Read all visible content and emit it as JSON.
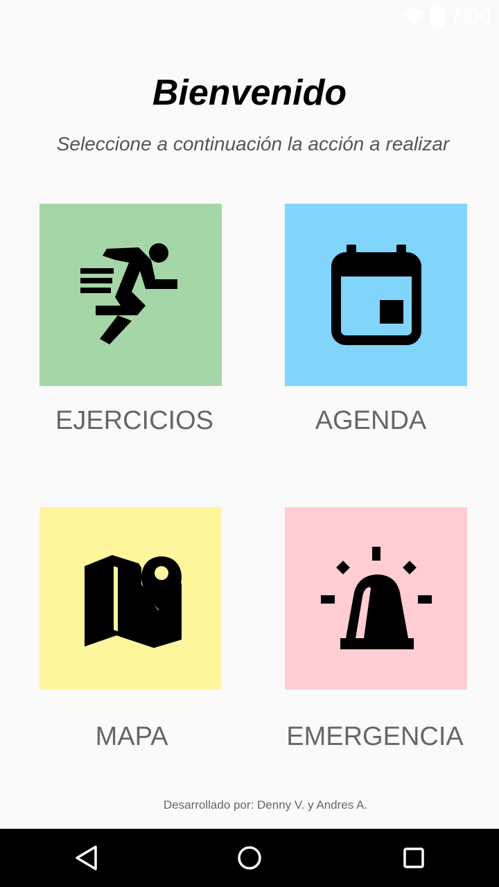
{
  "status_bar": {
    "time": "7:00",
    "icons": [
      "wifi-icon",
      "battery-icon"
    ]
  },
  "header": {
    "title": "Bienvenido",
    "subtitle": "Seleccione a continuación la acción a realizar"
  },
  "menu": [
    {
      "label": "EJERCICIOS",
      "icon": "running-person-icon",
      "color": "#a5d6a7"
    },
    {
      "label": "AGENDA",
      "icon": "calendar-icon",
      "color": "#81d4fa"
    },
    {
      "label": "MAPA",
      "icon": "map-pin-icon",
      "color": "#fff59d"
    },
    {
      "label": "EMERGENCIA",
      "icon": "siren-icon",
      "color": "#ffcdd2"
    }
  ],
  "footer": {
    "credits": "Desarrollado por: Denny V. y Andres A."
  },
  "nav_bar": {
    "buttons": [
      "back-icon",
      "home-icon",
      "recents-icon"
    ]
  }
}
